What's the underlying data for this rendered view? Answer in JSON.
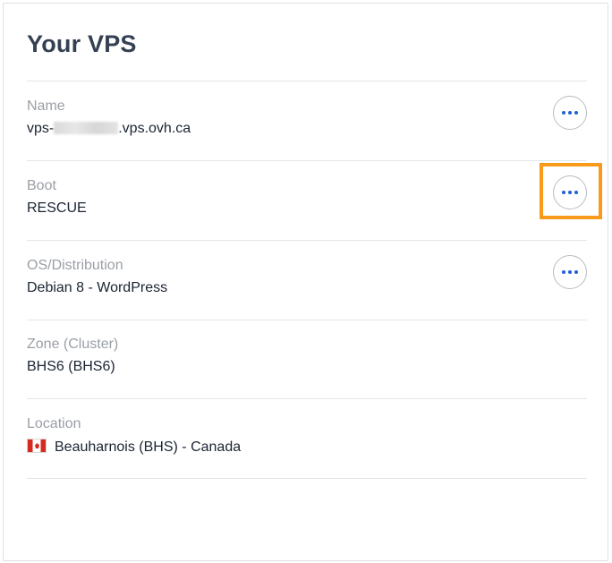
{
  "card": {
    "title": "Your VPS"
  },
  "rows": [
    {
      "label": "Name",
      "value_prefix": "vps-",
      "value_suffix": ".vps.ovh.ca",
      "has_actions": true
    },
    {
      "label": "Boot",
      "value": "RESCUE",
      "has_actions": true,
      "highlighted": true
    },
    {
      "label": "OS/Distribution",
      "value": "Debian 8 - WordPress",
      "has_actions": true
    },
    {
      "label": "Zone (Cluster)",
      "value": "BHS6 (BHS6)",
      "has_actions": false
    },
    {
      "label": "Location",
      "value": "Beauharnois (BHS) - Canada",
      "flag": "canada-flag-icon",
      "has_actions": false
    }
  ],
  "actions_icon": "ellipsis-icon",
  "colors": {
    "title": "#344153",
    "label": "#9a9fa6",
    "value": "#1a2433",
    "accent": "#1f5fd8",
    "highlight": "#f99b1a",
    "divider": "#e3e6ea"
  }
}
